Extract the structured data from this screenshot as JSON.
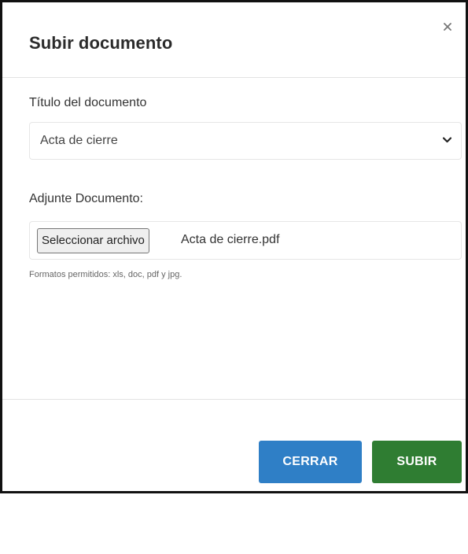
{
  "modal": {
    "title": "Subir documento",
    "close_icon": "close-icon"
  },
  "form": {
    "document_title_label": "Título del documento",
    "document_title_selected": "Acta de cierre",
    "attachment_label": "Adjunte Documento:",
    "file_button_label": "Seleccionar archivo",
    "file_name": "Acta de cierre.pdf",
    "help_text": "Formatos permitidos: xls, doc, pdf y jpg."
  },
  "footer": {
    "close_label": "CERRAR",
    "submit_label": "SUBIR"
  },
  "colors": {
    "close_button": "#2f7fc6",
    "submit_button": "#2f7d32",
    "border": "#e6e6e6"
  },
  "icons": {
    "dropdown": "chevron-down-icon"
  }
}
